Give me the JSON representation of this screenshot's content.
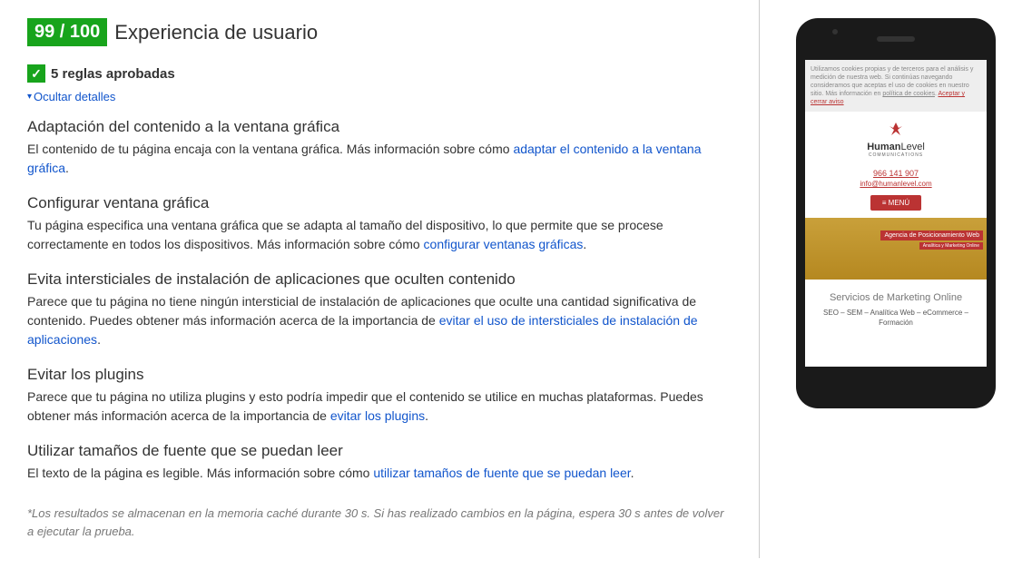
{
  "score": {
    "value": "99 / 100",
    "title": "Experiencia de usuario"
  },
  "passed": {
    "check": "✓",
    "label": "5 reglas aprobadas"
  },
  "toggle": {
    "caret": "▾",
    "label": "Ocultar detalles"
  },
  "rules": [
    {
      "title": "Adaptación del contenido a la ventana gráfica",
      "pre": "El contenido de tu página encaja con la ventana gráfica. Más información sobre cómo ",
      "link": "adaptar el contenido a la ventana gráfica",
      "post": "."
    },
    {
      "title": "Configurar ventana gráfica",
      "pre": "Tu página especifica una ventana gráfica que se adapta al tamaño del dispositivo, lo que permite que se procese correctamente en todos los dispositivos. Más información sobre cómo ",
      "link": "configurar ventanas gráficas",
      "post": "."
    },
    {
      "title": "Evita intersticiales de instalación de aplicaciones que oculten contenido",
      "pre": "Parece que tu página no tiene ningún intersticial de instalación de aplicaciones que oculte una cantidad significativa de contenido. Puedes obtener más información acerca de la importancia de ",
      "link": "evitar el uso de intersticiales de instalación de aplicaciones",
      "post": "."
    },
    {
      "title": "Evitar los plugins",
      "pre": "Parece que tu página no utiliza plugins y esto podría impedir que el contenido se utilice en muchas plataformas. Puedes obtener más información acerca de la importancia de ",
      "link": "evitar los plugins",
      "post": "."
    },
    {
      "title": "Utilizar tamaños de fuente que se puedan leer",
      "pre": "El texto de la página es legible. Más información sobre cómo ",
      "link": "utilizar tamaños de fuente que se puedan leer",
      "post": "."
    }
  ],
  "footnote": "*Los resultados se almacenan en la memoria caché durante 30 s. Si has realizado cambios en la página, espera 30 s antes de volver a ejecutar la prueba.",
  "preview": {
    "cookie_pre": "Utilizamos cookies propias y de terceros para el análisis y medición de nuestra web. Si continúas navegando consideramos que aceptas el uso de cookies en nuestro sitio. Más información en ",
    "cookie_link": "política de cookies",
    "cookie_sep": ". ",
    "cookie_accept": "Aceptar y cerrar aviso",
    "logo_name_1": "Human",
    "logo_name_2": "Level",
    "logo_sub": "COMMUNICATIONS",
    "phone": "966 141 907",
    "email": "info@humanlevel.com",
    "menu": "≡ MENÚ",
    "hero_1": "Agencia de Posicionamiento Web",
    "hero_2": "Analítica y Marketing Online",
    "services_title": "Servicios de Marketing Online",
    "services_sub": "SEO – SEM – Analítica Web – eCommerce – Formación"
  }
}
